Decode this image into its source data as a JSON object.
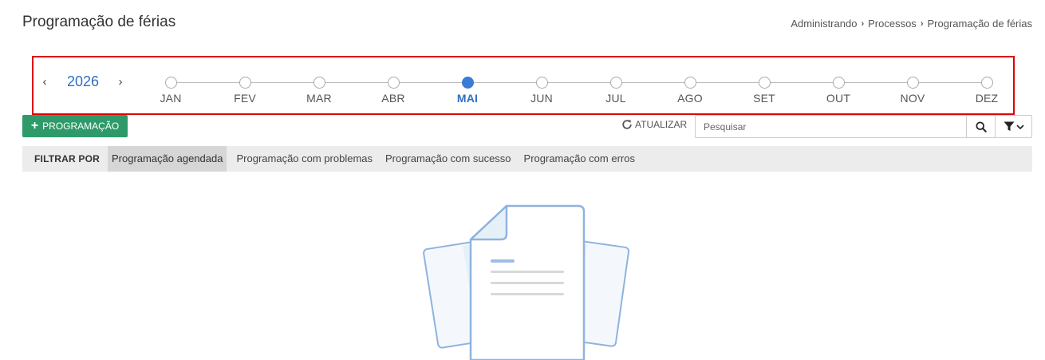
{
  "header": {
    "title": "Programação de férias",
    "breadcrumb": [
      "Administrando",
      "Processos",
      "Programação de férias"
    ]
  },
  "timeline": {
    "year": "2026",
    "selected_month": "MAI",
    "months": [
      "JAN",
      "FEV",
      "MAR",
      "ABR",
      "MAI",
      "JUN",
      "JUL",
      "AGO",
      "SET",
      "OUT",
      "NOV",
      "DEZ"
    ]
  },
  "toolbar": {
    "add_label": "PROGRAMAÇÃO",
    "refresh_label": "ATUALIZAR",
    "search_placeholder": "Pesquisar"
  },
  "filters": {
    "title": "FILTRAR POR",
    "active": "Programação agendada",
    "options": [
      "Programação agendada",
      "Programação com problemas",
      "Programação com sucesso",
      "Programação com erros"
    ]
  },
  "colors": {
    "accent": "#2e6fbf",
    "selected_dot": "#3a7bd5",
    "add_button": "#2e9a6a",
    "highlight_border": "#e00000",
    "filter_bar": "#ececec"
  },
  "icons": [
    "chevron-left-icon",
    "chevron-right-icon",
    "plus-icon",
    "refresh-icon",
    "search-icon",
    "filter-icon",
    "chevron-down-icon",
    "empty-document-icon"
  ]
}
